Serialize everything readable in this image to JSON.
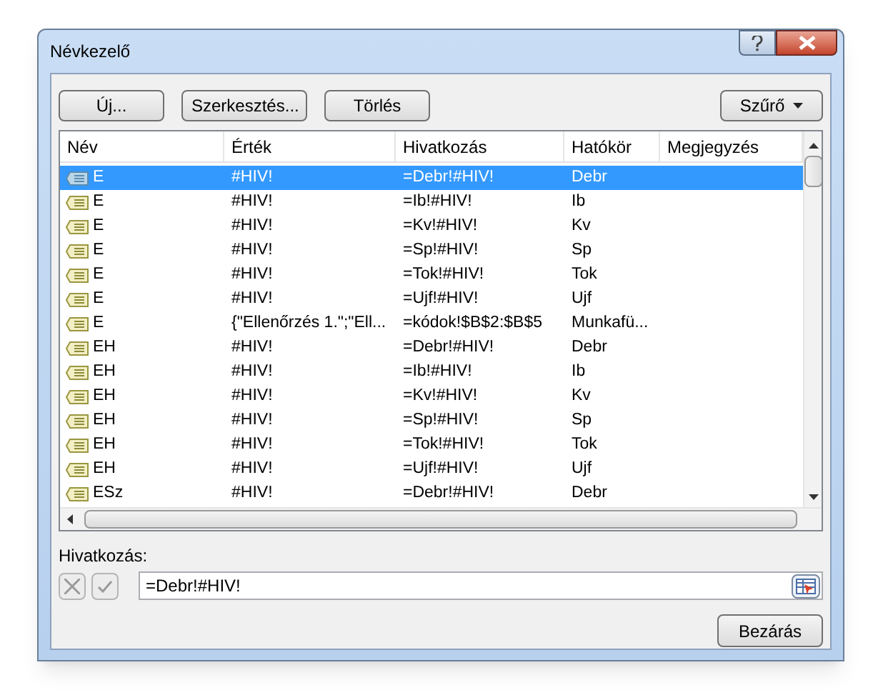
{
  "window": {
    "title": "Névkezelő"
  },
  "toolbar": [
    "Új...",
    "Szerkesztés...",
    "Törlés"
  ],
  "filter_button": "Szűrő",
  "table": {
    "columns": [
      "Név",
      "Érték",
      "Hivatkozás",
      "Hatókör",
      "Megjegyzés"
    ],
    "rows": [
      {
        "cells": [
          "E",
          "#HIV!",
          "=Debr!#HIV!",
          "Debr"
        ],
        "selected": true
      },
      {
        "cells": [
          "E",
          "#HIV!",
          "=Ib!#HIV!",
          "Ib"
        ],
        "selected": false
      },
      {
        "cells": [
          "E",
          "#HIV!",
          "=Kv!#HIV!",
          "Kv"
        ],
        "selected": false
      },
      {
        "cells": [
          "E",
          "#HIV!",
          "=Sp!#HIV!",
          "Sp"
        ],
        "selected": false
      },
      {
        "cells": [
          "E",
          "#HIV!",
          "=Tok!#HIV!",
          "Tok"
        ],
        "selected": false
      },
      {
        "cells": [
          "E",
          "#HIV!",
          "=Ujf!#HIV!",
          "Ujf"
        ],
        "selected": false
      },
      {
        "cells": [
          "E",
          "{\"Ellenőrzés 1.\";\"Ell...",
          "=kódok!$B$2:$B$5",
          "Munkafü..."
        ],
        "selected": false
      },
      {
        "cells": [
          "EH",
          "#HIV!",
          "=Debr!#HIV!",
          "Debr"
        ],
        "selected": false
      },
      {
        "cells": [
          "EH",
          "#HIV!",
          "=Ib!#HIV!",
          "Ib"
        ],
        "selected": false
      },
      {
        "cells": [
          "EH",
          "#HIV!",
          "=Kv!#HIV!",
          "Kv"
        ],
        "selected": false
      },
      {
        "cells": [
          "EH",
          "#HIV!",
          "=Sp!#HIV!",
          "Sp"
        ],
        "selected": false
      },
      {
        "cells": [
          "EH",
          "#HIV!",
          "=Tok!#HIV!",
          "Tok"
        ],
        "selected": false
      },
      {
        "cells": [
          "EH",
          "#HIV!",
          "=Ujf!#HIV!",
          "Ujf"
        ],
        "selected": false
      },
      {
        "cells": [
          "ESz",
          "#HIV!",
          "=Debr!#HIV!",
          "Debr"
        ],
        "selected": false
      }
    ]
  },
  "reference": {
    "label": "Hivatkozás:",
    "value": "=Debr!#HIV!"
  },
  "close_button": "Bezárás"
}
